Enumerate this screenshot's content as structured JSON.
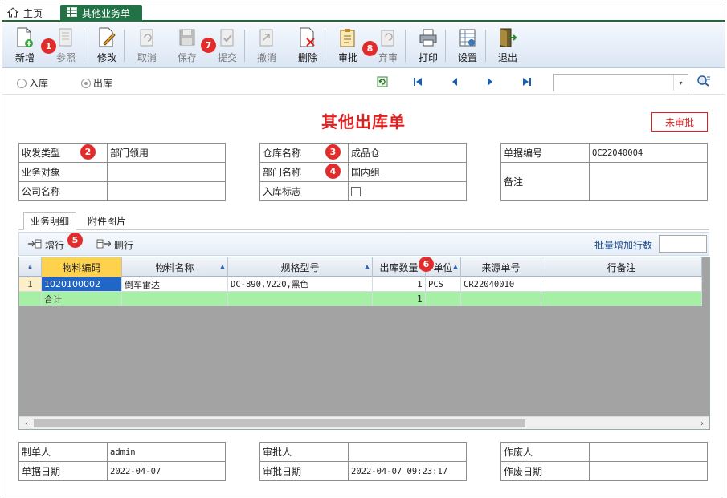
{
  "tabs": {
    "home_label": "主页",
    "active_label": "其他业务单"
  },
  "toolbar": {
    "buttons": [
      {
        "label": "新增",
        "icon": "new-doc-icon",
        "enabled": true
      },
      {
        "label": "参照",
        "icon": "reference-icon",
        "enabled": false
      },
      {
        "label": "修改",
        "icon": "edit-icon",
        "enabled": true
      },
      {
        "label": "取消",
        "icon": "cancel-icon",
        "enabled": false
      },
      {
        "label": "保存",
        "icon": "save-icon",
        "enabled": false
      },
      {
        "label": "提交",
        "icon": "submit-icon",
        "enabled": false
      },
      {
        "label": "撤消",
        "icon": "revoke-icon",
        "enabled": false
      },
      {
        "label": "删除",
        "icon": "delete-icon",
        "enabled": true
      },
      {
        "label": "审批",
        "icon": "approve-icon",
        "enabled": true
      },
      {
        "label": "弃审",
        "icon": "unapprove-icon",
        "enabled": false
      },
      {
        "label": "打印",
        "icon": "print-icon",
        "enabled": true
      },
      {
        "label": "设置",
        "icon": "settings-icon",
        "enabled": true
      },
      {
        "label": "退出",
        "icon": "exit-icon",
        "enabled": true
      }
    ]
  },
  "markers": [
    "1",
    "2",
    "3",
    "4",
    "5",
    "6",
    "7",
    "8"
  ],
  "nav": {
    "radio_in": "入库",
    "radio_out": "出库",
    "selected": "出库",
    "combo_value": ""
  },
  "document": {
    "title": "其他出库单",
    "status": "未审批"
  },
  "form_left": {
    "rows": [
      {
        "label": "收发类型",
        "value": "部门领用"
      },
      {
        "label": "业务对象",
        "value": ""
      },
      {
        "label": "公司名称",
        "value": ""
      }
    ]
  },
  "form_mid": {
    "rows": [
      {
        "label": "仓库名称",
        "value": "成品仓"
      },
      {
        "label": "部门名称",
        "value": "国内组"
      },
      {
        "label": "入库标志",
        "value": ""
      }
    ],
    "checkbox_checked": false
  },
  "form_right": {
    "doc_no_label": "单据编号",
    "doc_no": "QC22040004",
    "remark_label": "备注",
    "remark": ""
  },
  "detail": {
    "tab_active": "业务明细",
    "tab_other": "附件图片",
    "add_row": "增行",
    "delete_row": "删行",
    "batch_label": "批量增加行数",
    "batch_value": ""
  },
  "grid": {
    "columns": [
      "物料编码",
      "物料名称",
      "规格型号",
      "出库数量",
      "单位",
      "来源单号",
      "行备注"
    ],
    "rows": [
      {
        "no": "1",
        "code": "1020100002",
        "name": "倒车雷达",
        "spec": "DC-890,V220,黑色",
        "qty": "1",
        "unit": "PCS",
        "source": "CR22040010",
        "remark": ""
      }
    ],
    "total": {
      "label": "合计",
      "qty": "1"
    }
  },
  "footer_left": {
    "rows": [
      {
        "label": "制单人",
        "value": "admin"
      },
      {
        "label": "单据日期",
        "value": "2022-04-07"
      }
    ]
  },
  "footer_mid": {
    "rows": [
      {
        "label": "审批人",
        "value": ""
      },
      {
        "label": "审批日期",
        "value": "2022-04-07 09:23:17"
      }
    ]
  },
  "footer_right": {
    "rows": [
      {
        "label": "作废人",
        "value": ""
      },
      {
        "label": "作废日期",
        "value": ""
      }
    ]
  },
  "colors": {
    "accent_green": "#217346",
    "title_red": "#e02020",
    "marker_red": "#e22c2c",
    "total_row": "#a6f0a6",
    "selected_header": "#ffd24d"
  }
}
